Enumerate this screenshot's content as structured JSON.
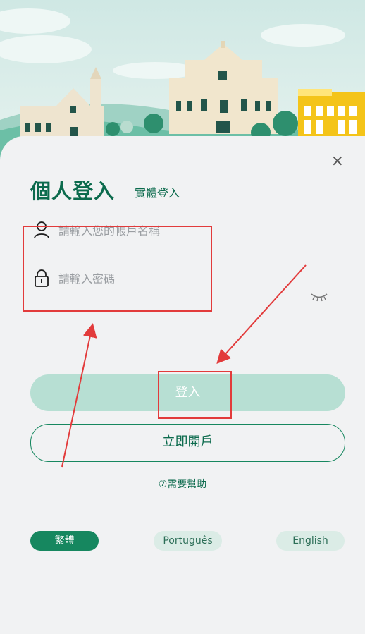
{
  "header": {
    "title": "個人登入",
    "alt_tab": "實體登入",
    "close_symbol": "×"
  },
  "form": {
    "username_placeholder": "請輸入您的帳戶名稱",
    "password_placeholder": "請輸入密碼"
  },
  "buttons": {
    "login": "登入",
    "open_account": "立即開戶"
  },
  "help": {
    "label": "⑦需要幫助"
  },
  "languages": [
    {
      "label": "繁體",
      "selected": true
    },
    {
      "label": "Português",
      "selected": false
    },
    {
      "label": "English",
      "selected": false
    }
  ],
  "colors": {
    "brand": "#0c6b4d",
    "accent": "#16875f",
    "login_bg": "#b7dfd3",
    "highlight": "#e23b3b"
  }
}
